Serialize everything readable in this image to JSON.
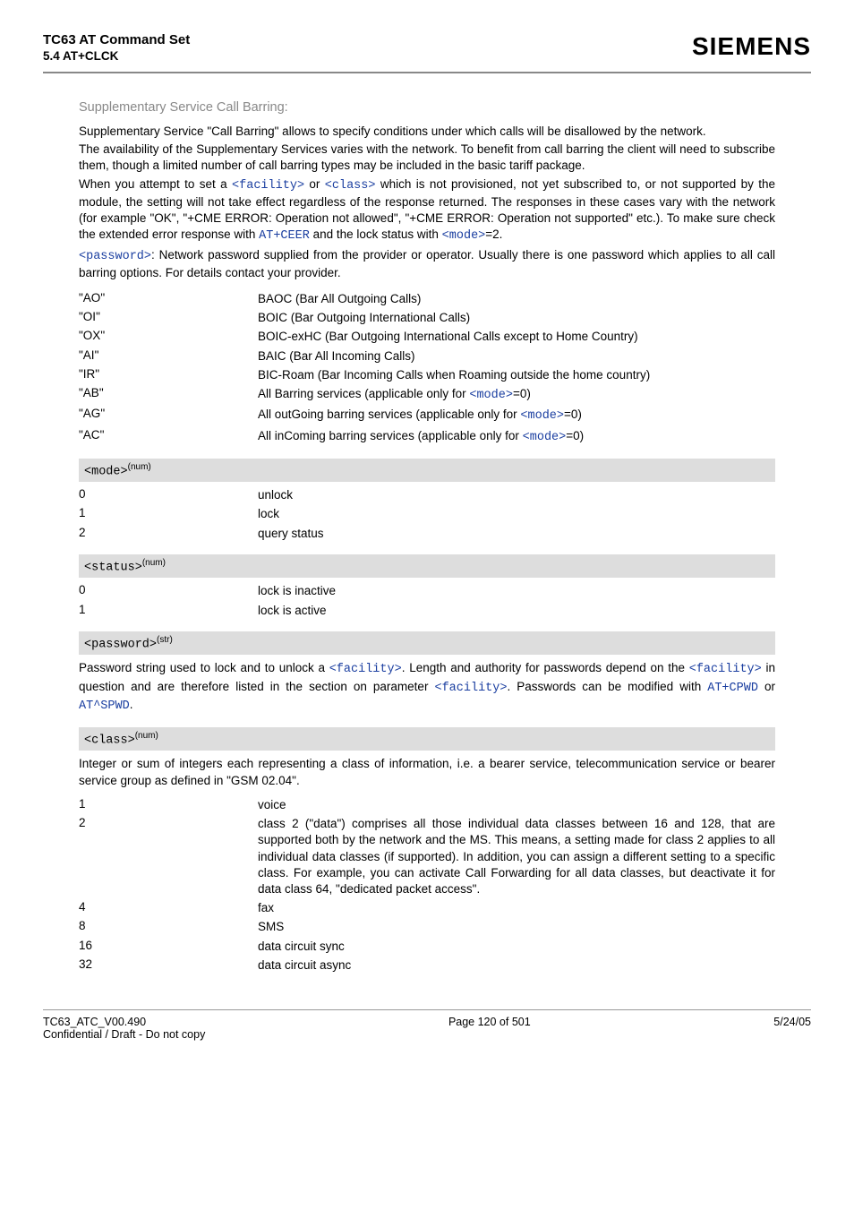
{
  "header": {
    "doc_title": "TC63 AT Command Set",
    "doc_section": "5.4 AT+CLCK",
    "brand": "SIEMENS"
  },
  "intro": {
    "subhead": "Supplementary Service Call Barring:",
    "p1": "Supplementary Service \"Call Barring\" allows to specify conditions under which calls will be disallowed by the network.",
    "p2": "The availability of the Supplementary Services varies with the network. To benefit from call barring the client will need to subscribe them, though a limited number of call barring types may be included in the basic tariff package.",
    "p3a": "When you attempt to set a ",
    "p3b": " or ",
    "p3c": " which is not provisioned, not yet subscribed to, or not supported by the module, the setting will not take effect regardless of the response returned. The responses in these cases vary with the network (for example \"OK\", \"+CME ERROR: Operation not allowed\", \"+CME ERROR: Operation not supported\" etc.). To make sure check the extended error response with ",
    "p3d": " and the lock status with ",
    "p3e": "=2.",
    "p4a": ": Network password supplied from the provider or operator. Usually there is one password which applies to all call barring options. For details contact your provider.",
    "code_facility": "<facility>",
    "code_class": "<class>",
    "code_atceer": "AT+CEER",
    "code_mode": "<mode>",
    "code_password": "<password>"
  },
  "barring": [
    {
      "key": "AO",
      "val": "BAOC (Bar All Outgoing Calls)"
    },
    {
      "key": "OI",
      "val": "BOIC (Bar Outgoing International Calls)"
    },
    {
      "key": "OX",
      "val": "BOIC-exHC (Bar Outgoing International Calls except to Home Country)"
    },
    {
      "key": "AI",
      "val": "BAIC (Bar All Incoming Calls)"
    },
    {
      "key": "IR",
      "val": "BIC-Roam (Bar Incoming Calls when Roaming outside the home country)"
    }
  ],
  "barring_mode": [
    {
      "key": "AB",
      "pre": "All Barring services (applicable only for ",
      "post": "=0)"
    },
    {
      "key": "AG",
      "pre": "All outGoing barring services (applicable only for ",
      "post": "=0)"
    },
    {
      "key": "AC",
      "pre": "All inComing barring services (applicable only for ",
      "post": "=0)"
    }
  ],
  "mode_header": "<mode>",
  "mode_sup": "(num)",
  "mode": [
    {
      "key": "0",
      "val": "unlock"
    },
    {
      "key": "1",
      "val": "lock"
    },
    {
      "key": "2",
      "val": "query status"
    }
  ],
  "status_header": "<status>",
  "status_sup": "(num)",
  "status": [
    {
      "key": "0",
      "val": "lock is inactive"
    },
    {
      "key": "1",
      "val": "lock is active"
    }
  ],
  "password_header": "<password>",
  "password_sup": "(str)",
  "password_desc": {
    "a": "Password string used to lock and to unlock a ",
    "b": ". Length and authority for passwords depend on the ",
    "c": " in question and are therefore listed in the section on parameter ",
    "d": ". Passwords can be modified with ",
    "e": " or ",
    "f": ".",
    "code1": "<facility>",
    "code2": "<facility>",
    "code3": "<facility>",
    "code4": "AT+CPWD",
    "code5": "AT^SPWD"
  },
  "class_header": "<class>",
  "class_sup": "(num)",
  "class_desc": "Integer or sum of integers each representing a class of information, i.e. a bearer service, telecommunication service or bearer service group as defined in \"GSM 02.04\".",
  "class": [
    {
      "key": "1",
      "val": "voice"
    },
    {
      "key": "2",
      "val": "class 2 (\"data\") comprises all those individual data classes between 16 and 128, that are supported both by the network and the MS. This means, a setting made for class 2 applies to all individual data classes (if supported). In addition, you can assign a different setting to a specific class. For example, you can activate Call Forwarding for all data classes, but deactivate it for data class 64, \"dedicated packet access\"."
    },
    {
      "key": "4",
      "val": "fax"
    },
    {
      "key": "8",
      "val": "SMS"
    },
    {
      "key": "16",
      "val": "data circuit sync"
    },
    {
      "key": "32",
      "val": "data circuit async"
    }
  ],
  "footer": {
    "left1": "TC63_ATC_V00.490",
    "left2": "Confidential / Draft - Do not copy",
    "center": "Page 120 of 501",
    "right": "5/24/05"
  }
}
